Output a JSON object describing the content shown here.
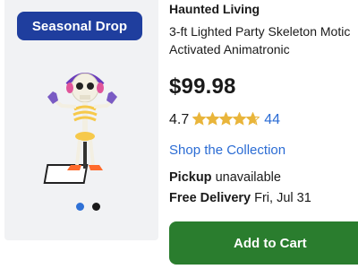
{
  "badge": {
    "label": "Seasonal Drop"
  },
  "product": {
    "brand": "Haunted Living",
    "title_line1": "3-ft Lighted Party Skeleton Motic",
    "title_line2": "Activated Animatronic",
    "price": "$99.98",
    "rating": "4.7",
    "rating_fraction": 0.94,
    "review_count": "44"
  },
  "links": {
    "shop": "Shop the Collection"
  },
  "fulfillment": {
    "pickup_label": "Pickup",
    "pickup_value": "unavailable",
    "delivery_label": "Free Delivery",
    "delivery_value": "Fri, Jul 31"
  },
  "carousel": {
    "count": 2,
    "active": 0
  },
  "actions": {
    "add_to_cart": "Add to Cart"
  },
  "colors": {
    "badge_bg": "#1f3e9e",
    "link": "#2b6cd4",
    "cart_button": "#2a7d2e",
    "star": "#e9b53b",
    "dot_active": "#2f71d6"
  },
  "icons": {
    "star": "star-icon"
  }
}
